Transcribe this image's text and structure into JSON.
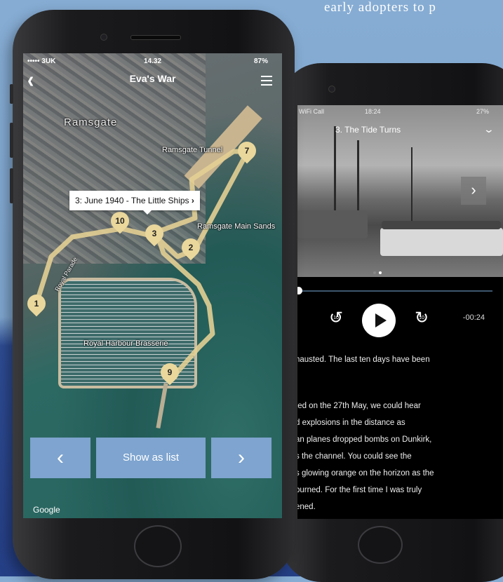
{
  "background": {
    "tagline_fragment": "early adopters to p"
  },
  "front_phone": {
    "status": {
      "carrier": "••••• 3UK",
      "time": "14.32",
      "battery": "87%"
    },
    "header": {
      "title": "Eva's War"
    },
    "map_labels": [
      "Ramsgate",
      "Ramsgate Tunnel",
      "Ramsgate Main Sands",
      "Royal Parade",
      "Royal Harbour Brasserie"
    ],
    "tooltip": "3: June 1940 - The Little Ships",
    "pins": [
      "1",
      "2",
      "3",
      "7",
      "9",
      "10"
    ],
    "buttons": {
      "prev": "‹",
      "list": "Show as list",
      "next": "›"
    },
    "attribution": "Google"
  },
  "back_phone": {
    "status": {
      "carrier": "WiFi Call",
      "time": "18:24",
      "battery": "27%"
    },
    "track_title": "3. The Tide Turns",
    "player": {
      "skip_back": "10",
      "skip_fwd": "10",
      "remaining": "-00:24"
    },
    "lines": [
      "hausted. The last ten days have been",
      "",
      "ted on the 27th May, we could hear",
      "d explosions in the distance as",
      "an planes dropped bombs on Dunkirk,",
      "s the channel. You could see the",
      "s glowing orange on the horizon as the",
      "burned. For the first time I was truly",
      "ened."
    ]
  },
  "colors": {
    "pin": "#ead79b",
    "button": "#7ea4cf",
    "background_top": "#86acd3",
    "background_bottom": "#253f86"
  }
}
